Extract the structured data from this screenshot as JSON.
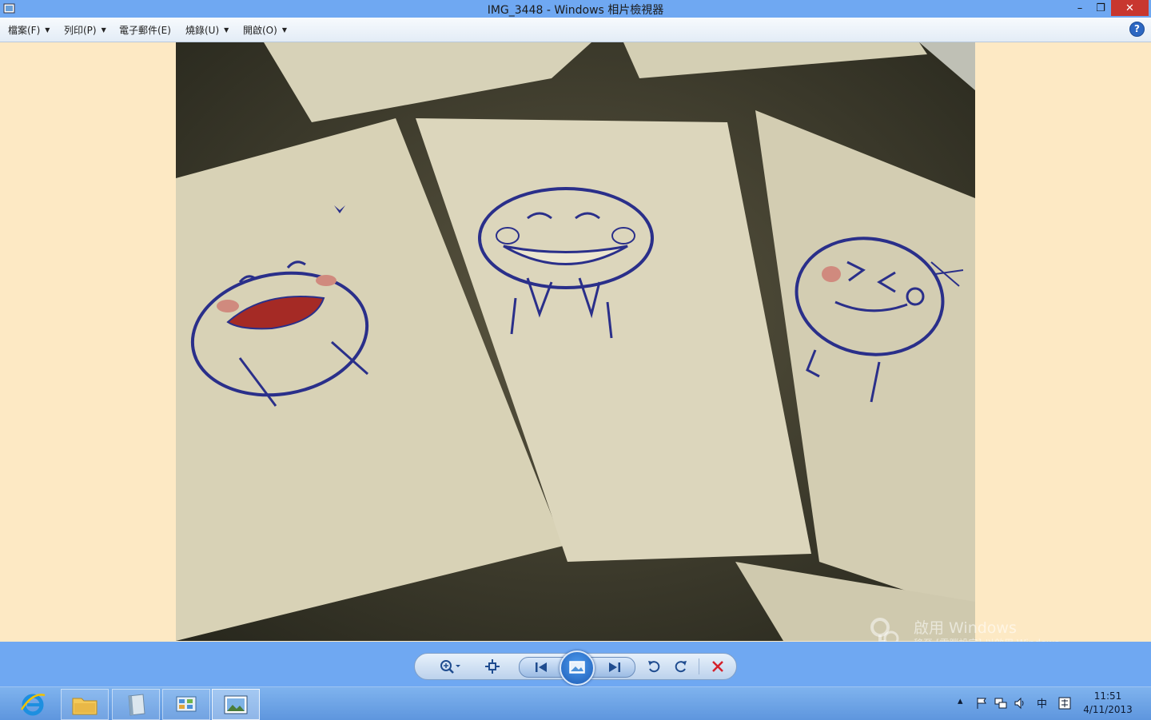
{
  "window": {
    "title": "IMG_3448 - Windows 相片檢視器",
    "minimize_label": "–",
    "maximize_label": "❐",
    "close_label": "✕"
  },
  "menu": {
    "items": [
      {
        "label": "檔案(F)",
        "has_dropdown": true
      },
      {
        "label": "列印(P)",
        "has_dropdown": true
      },
      {
        "label": "電子郵件(E)",
        "has_dropdown": false
      },
      {
        "label": "燒錄(U)",
        "has_dropdown": true
      },
      {
        "label": "開啟(O)",
        "has_dropdown": true
      }
    ],
    "help_label": "?"
  },
  "photo": {
    "description_icon": "photo-image"
  },
  "watermark": {
    "title": "啟用 Windows",
    "subtitle": "移至 [電腦設定] 以啟用 Windows"
  },
  "controls": {
    "zoom_icon": "zoom-icon",
    "fit_icon": "actual-size-icon",
    "prev_icon": "previous-icon",
    "slideshow_icon": "slideshow-icon",
    "next_icon": "next-icon",
    "rotate_ccw_icon": "rotate-counterclockwise-icon",
    "rotate_cw_icon": "rotate-clockwise-icon",
    "delete_icon": "delete-icon"
  },
  "taskbar": {
    "apps": [
      "internet-explorer",
      "file-explorer",
      "notebook-app",
      "control-panel",
      "photo-viewer"
    ],
    "tray": {
      "overflow": "▴",
      "ime": "中"
    },
    "clock": {
      "time": "11:51",
      "date": "4/11/2013"
    }
  },
  "colors": {
    "titlebar": "#6fa8f2",
    "close": "#c8372f",
    "background": "#fde9c4"
  }
}
